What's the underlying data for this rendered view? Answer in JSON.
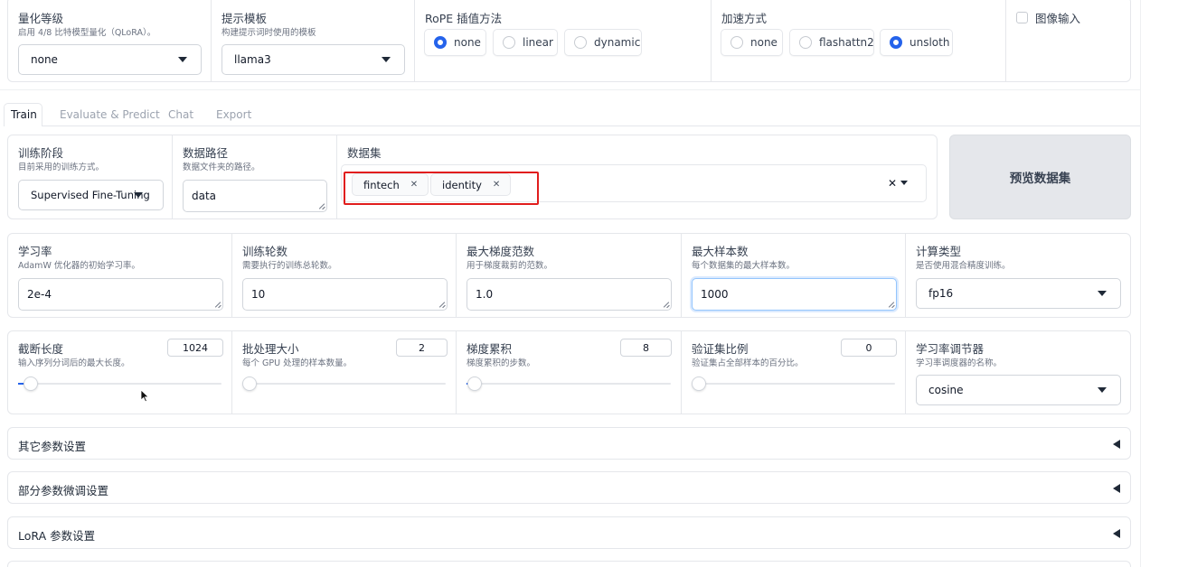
{
  "top": {
    "quant": {
      "label": "量化等级",
      "hint": "启用 4/8 比特模型量化（QLoRA）。",
      "value": "none"
    },
    "template": {
      "label": "提示模板",
      "hint": "构建提示词时使用的模板",
      "value": "llama3"
    },
    "rope": {
      "label": "RoPE 插值方法",
      "options": [
        "none",
        "linear",
        "dynamic"
      ],
      "selected": "none"
    },
    "accel": {
      "label": "加速方式",
      "options": [
        "none",
        "flashattn2",
        "unsloth"
      ],
      "selected": "unsloth"
    },
    "image_input": {
      "label": "图像输入",
      "checked": false
    }
  },
  "tabs": [
    "Train",
    "Evaluate & Predict",
    "Chat",
    "Export"
  ],
  "active_tab": "Train",
  "row1": {
    "stage": {
      "label": "训练阶段",
      "hint": "目前采用的训练方式。",
      "value": "Supervised Fine-Tuning"
    },
    "data_dir": {
      "label": "数据路径",
      "hint": "数据文件夹的路径。",
      "value": "data"
    },
    "dataset": {
      "label": "数据集",
      "chips": [
        "fintech",
        "identity"
      ],
      "highlight_color": "#e11d1d"
    },
    "preview_button": "预览数据集"
  },
  "row2": [
    {
      "label": "学习率",
      "hint": "AdamW 优化器的初始学习率。",
      "value": "2e-4"
    },
    {
      "label": "训练轮数",
      "hint": "需要执行的训练总轮数。",
      "value": "10"
    },
    {
      "label": "最大梯度范数",
      "hint": "用于梯度裁剪的范数。",
      "value": "1.0"
    },
    {
      "label": "最大样本数",
      "hint": "每个数据集的最大样本数。",
      "value": "1000"
    },
    {
      "label": "计算类型",
      "hint": "是否使用混合精度训练。",
      "value": "fp16"
    }
  ],
  "row3": [
    {
      "label": "截断长度",
      "hint": "输入序列分词后的最大长度。",
      "value": "1024",
      "level": 0.03
    },
    {
      "label": "批处理大小",
      "hint": "每个 GPU 处理的样本数量。",
      "value": "2",
      "level": 0.0
    },
    {
      "label": "梯度累积",
      "hint": "梯度累积的步数。",
      "value": "8",
      "level": 0.01
    },
    {
      "label": "验证集比例",
      "hint": "验证集占全部样本的百分比。",
      "value": "0",
      "level": 0.0
    },
    {
      "label": "学习率调节器",
      "hint": "学习率调度器的名称。",
      "value": "cosine"
    }
  ],
  "accordions": [
    "其它参数设置",
    "部分参数微调设置",
    "LoRA 参数设置"
  ],
  "colors": {
    "accent": "#2563eb",
    "border": "#e5e7eb",
    "button_bg": "#e5e7eb"
  }
}
